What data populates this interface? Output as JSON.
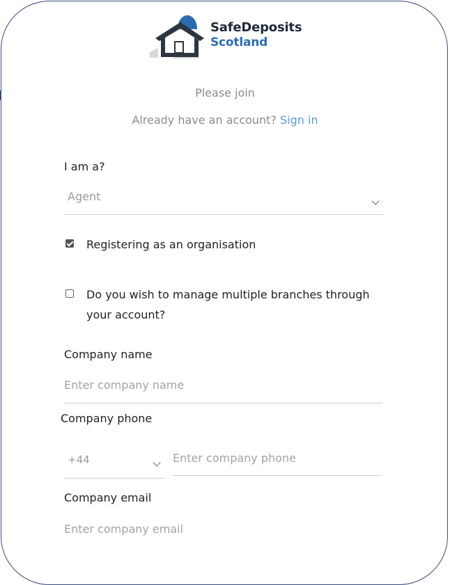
{
  "brand": {
    "line1": "SafeDeposits",
    "line2": "Scotland",
    "house_color": "#2d3540",
    "dome_color": "#2d6bb0"
  },
  "header": {
    "title": "Please join",
    "account_prompt": "Already have an account?",
    "signin_link": "Sign in"
  },
  "role": {
    "label": "I am a?",
    "selected": "Agent"
  },
  "options": {
    "organisation": {
      "label": "Registering as an organisation",
      "checked": true
    },
    "branches": {
      "label_line1": "Do you wish to manage multiple branches through",
      "label_line2": "your account?",
      "checked": false
    }
  },
  "company_name": {
    "label": "Company name",
    "placeholder": "Enter  company name"
  },
  "company_phone": {
    "label": "Company phone",
    "country_code": "+44",
    "placeholder": "Enter company phone"
  },
  "company_email": {
    "label": "Company email",
    "placeholder": "Enter  company email"
  },
  "colors": {
    "accent_link": "#5a9bd4",
    "border": "#3b4a7a"
  }
}
